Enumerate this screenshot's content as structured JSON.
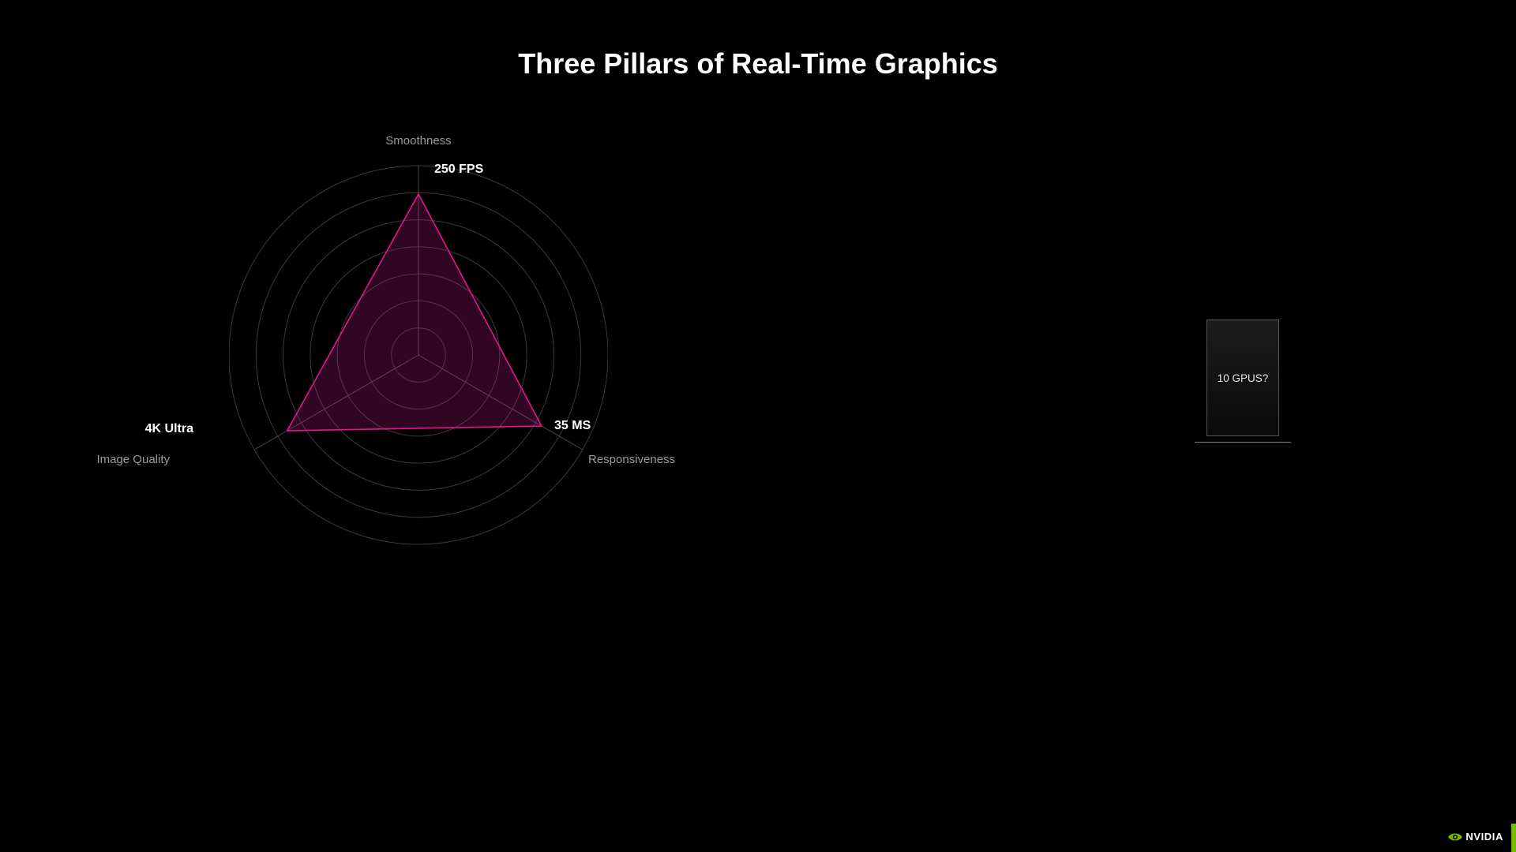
{
  "title": "Three Pillars of Real-Time Graphics",
  "chart_data": {
    "type": "radar",
    "axes": [
      {
        "name": "Smoothness",
        "angle_deg": -90,
        "value_label": "250 FPS",
        "value_frac": 0.85
      },
      {
        "name": "Responsiveness",
        "angle_deg": 30,
        "value_label": "35 MS",
        "value_frac": 0.75
      },
      {
        "name": "Image Quality",
        "angle_deg": 150,
        "value_label": "4K Ultra",
        "value_frac": 0.8
      }
    ],
    "rings": 7,
    "triangle_fill": "#c4198a",
    "triangle_fill_opacity": 0.25,
    "triangle_stroke": "#e5158d"
  },
  "side_box": {
    "label": "10 GPUS?"
  },
  "brand": {
    "name": "NVIDIA"
  }
}
